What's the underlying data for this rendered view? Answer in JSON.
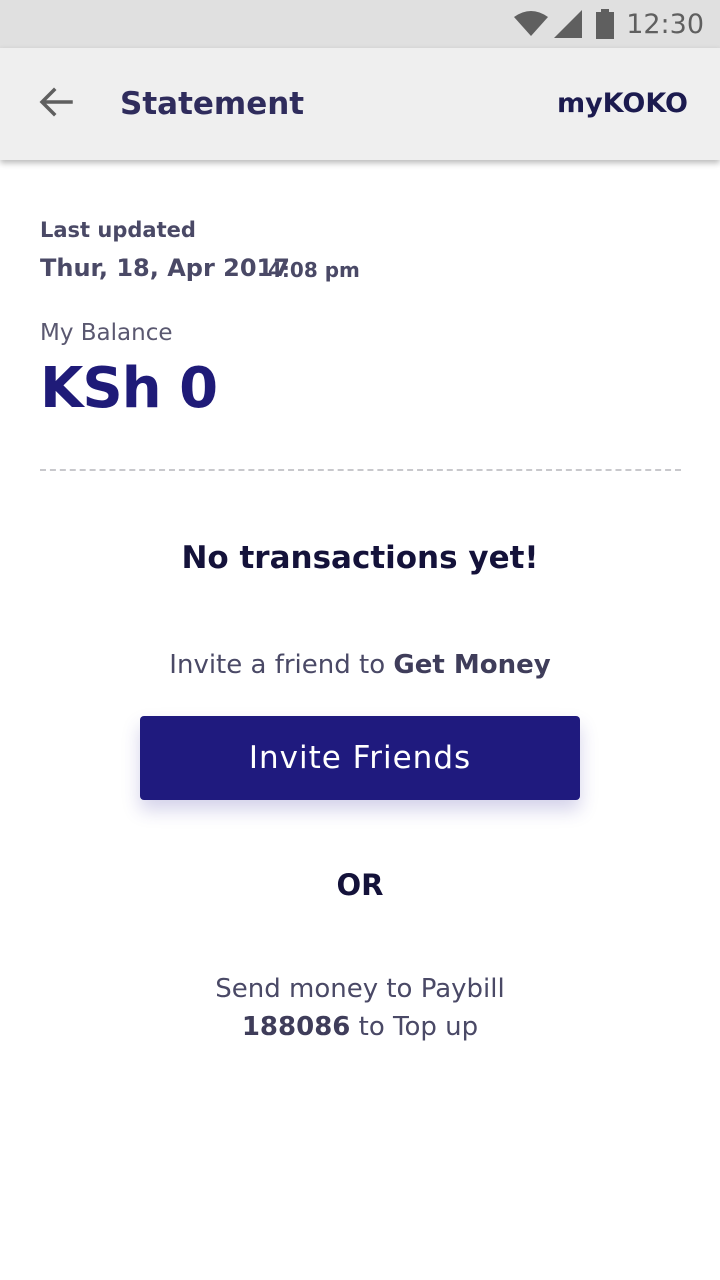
{
  "status_bar": {
    "time": "12:30",
    "icons": [
      "wifi-icon",
      "signal-icon",
      "battery-icon"
    ]
  },
  "app_bar": {
    "back_icon": "arrow-left-icon",
    "title": "Statement",
    "brand": "myKOKO"
  },
  "statement": {
    "last_updated_label": "Last updated",
    "last_updated_date": "Thur, 18, Apr 2017",
    "last_updated_time": "4:08 pm",
    "balance_label": "My Balance",
    "balance_amount": "KSh 0"
  },
  "empty_state": {
    "title": "No transactions yet!",
    "invite_prefix": "Invite a friend to ",
    "invite_highlight": "Get Money",
    "invite_button_label": "Invite Friends",
    "or_label": "OR",
    "paybill_line1": "Send money to Paybill",
    "paybill_number": "188086",
    "paybill_suffix": " to Top up"
  },
  "colors": {
    "primary": "#1f1a7e",
    "app_bar_bg": "#efefef",
    "status_bar_bg": "#e0e0e0",
    "text_dark": "#14123a",
    "text_muted": "#4a4966"
  }
}
